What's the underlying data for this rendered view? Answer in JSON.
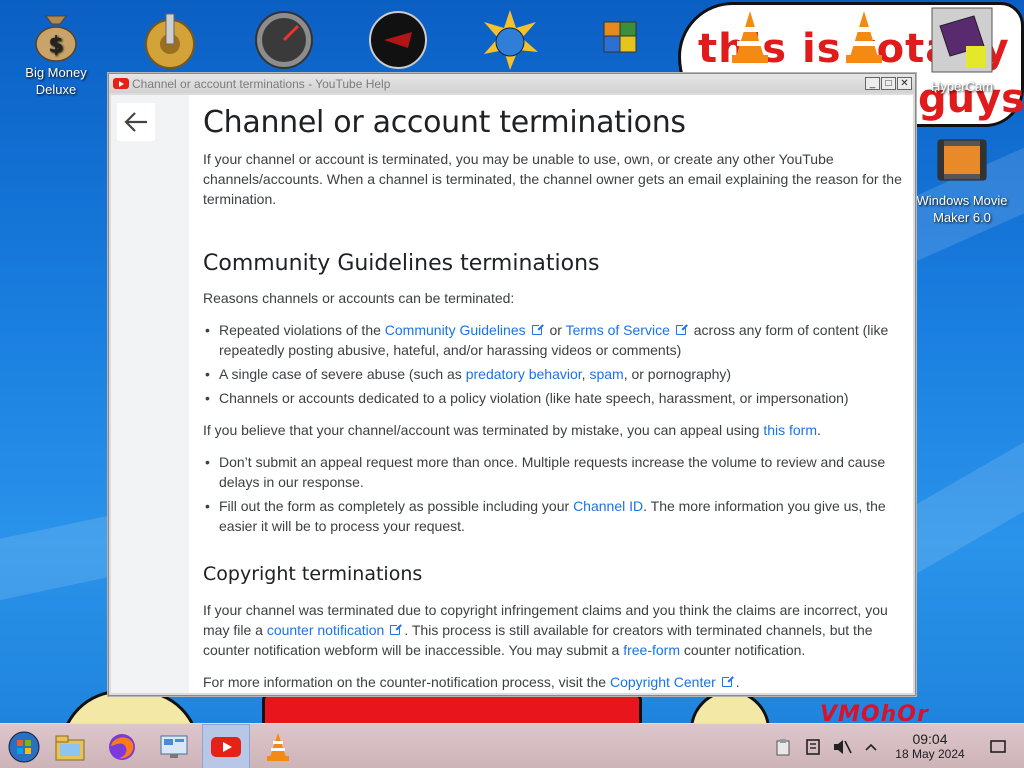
{
  "desktop": {
    "icons": [
      {
        "label": "Big Money Deluxe",
        "icon": "money-bag-icon"
      },
      {
        "label": "HyperCam",
        "icon": "hypercam-icon"
      },
      {
        "label": "Windows Movie Maker 6.0",
        "icon": "movie-maker-icon"
      }
    ],
    "meme_text_line1": "this is totally",
    "meme_text_line2": "guys",
    "watermark": "VMOhOr"
  },
  "window": {
    "title": "Channel or account terminations - YouTube Help",
    "buttons": {
      "minimize": "_",
      "maximize": "□",
      "close": "✕"
    }
  },
  "article": {
    "title": "Channel or account terminations",
    "intro": "If your channel or account is terminated, you may be unable to use, own, or create any other YouTube channels/accounts. When a channel is terminated, the channel owner gets an email explaining the reason for the termination.",
    "section1": {
      "heading": "Community Guidelines terminations",
      "lead": "Reasons channels or accounts can be terminated:",
      "b1_pre": "Repeated violations of the ",
      "b1_link1": "Community Guidelines",
      "b1_mid": " or ",
      "b1_link2": "Terms of Service",
      "b1_post": " across any form of content (like repeatedly posting abusive, hateful, and/or harassing videos or comments)",
      "b2_pre": "A single case of severe abuse (such as ",
      "b2_link1": "predatory behavior",
      "b2_mid": ", ",
      "b2_link2": "spam",
      "b2_post": ", or pornography)",
      "b3": "Channels or accounts dedicated to a policy violation (like hate speech, harassment, or impersonation)",
      "appeal_pre": "If you believe that your channel/account was terminated by mistake, you can appeal using ",
      "appeal_link": "this form",
      "appeal_post": ".",
      "b4": "Don’t submit an appeal request more than once. Multiple requests increase the volume to review and cause delays in our response.",
      "b5_pre": "Fill out the form as completely as possible including your ",
      "b5_link": "Channel ID",
      "b5_post": ". The more information you give us, the easier it will be to process your request."
    },
    "section2": {
      "heading": "Copyright terminations",
      "p1_pre": "If your channel was terminated due to copyright infringement claims and you think the claims are incorrect, you may file a ",
      "p1_link": "counter notification",
      "p1_mid": ". This process is still available for creators with terminated channels, but the counter notification webform will be inaccessible. You may submit a ",
      "p1_link2": "free-form",
      "p1_post": " counter notification.",
      "p2_pre": "For more information on the counter-notification process, visit the ",
      "p2_link": "Copyright Center",
      "p2_post": "."
    }
  },
  "taskbar": {
    "items": [
      "start-orb-icon",
      "file-manager-icon",
      "firefox-icon",
      "control-panel-icon",
      "youtube-icon",
      "vlc-icon"
    ],
    "active": "youtube-icon",
    "time": "09:04",
    "date": "18 May 2024"
  },
  "colors": {
    "link": "#1a73e8",
    "text": "#3c4043",
    "heading": "#202124",
    "youtube_red": "#e62117"
  }
}
